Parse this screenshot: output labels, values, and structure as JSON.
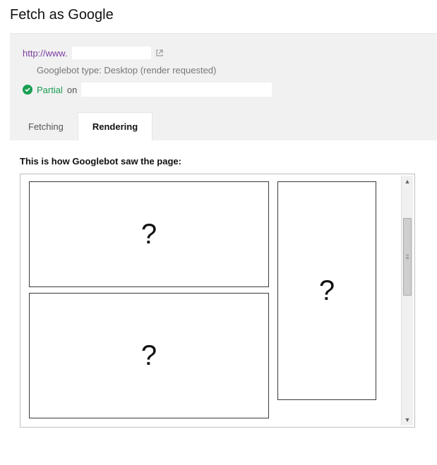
{
  "page": {
    "title": "Fetch as Google"
  },
  "info": {
    "url_prefix": "http://www.",
    "googlebot_type": "Googlebot type: Desktop (render requested)",
    "status": "Partial",
    "status_on": "on"
  },
  "tabs": {
    "fetching": "Fetching",
    "rendering": "Rendering"
  },
  "render": {
    "heading": "This is how Googlebot saw the page:",
    "placeholder_glyph": "?"
  }
}
